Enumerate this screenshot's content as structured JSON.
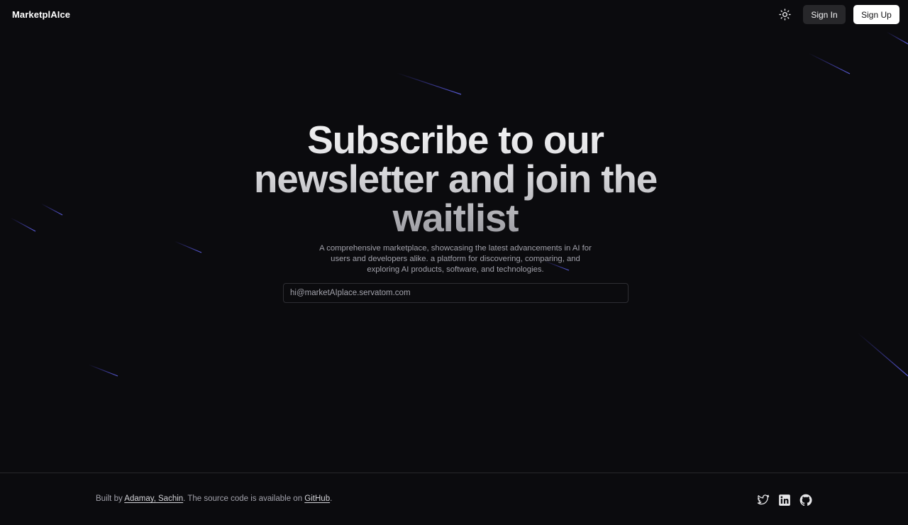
{
  "header": {
    "brand": "MarketplAIce",
    "theme_toggle_icon": "sun-icon",
    "sign_in_label": "Sign In",
    "sign_up_label": "Sign Up"
  },
  "hero": {
    "title": "Subscribe to our newsletter and join the waitlist",
    "subtitle": "A comprehensive marketplace, showcasing the latest advancements in AI for users and developers alike. a platform for discovering, comparing, and exploring AI products, software, and technologies.",
    "email_placeholder": "hi@marketAIplace.servatom.com"
  },
  "footer": {
    "built_by_prefix": "Built by ",
    "authors_link": "Adamay, Sachin",
    "middle_text": ". The source code is available on ",
    "github_link": "GitHub",
    "suffix": ".",
    "social_icons": [
      "twitter-icon",
      "linkedin-icon",
      "github-icon"
    ]
  },
  "colors": {
    "background": "#0b0b0e",
    "streak": "#4f46e5",
    "primary_button_bg": "#ffffff",
    "secondary_button_bg": "#27272a"
  }
}
